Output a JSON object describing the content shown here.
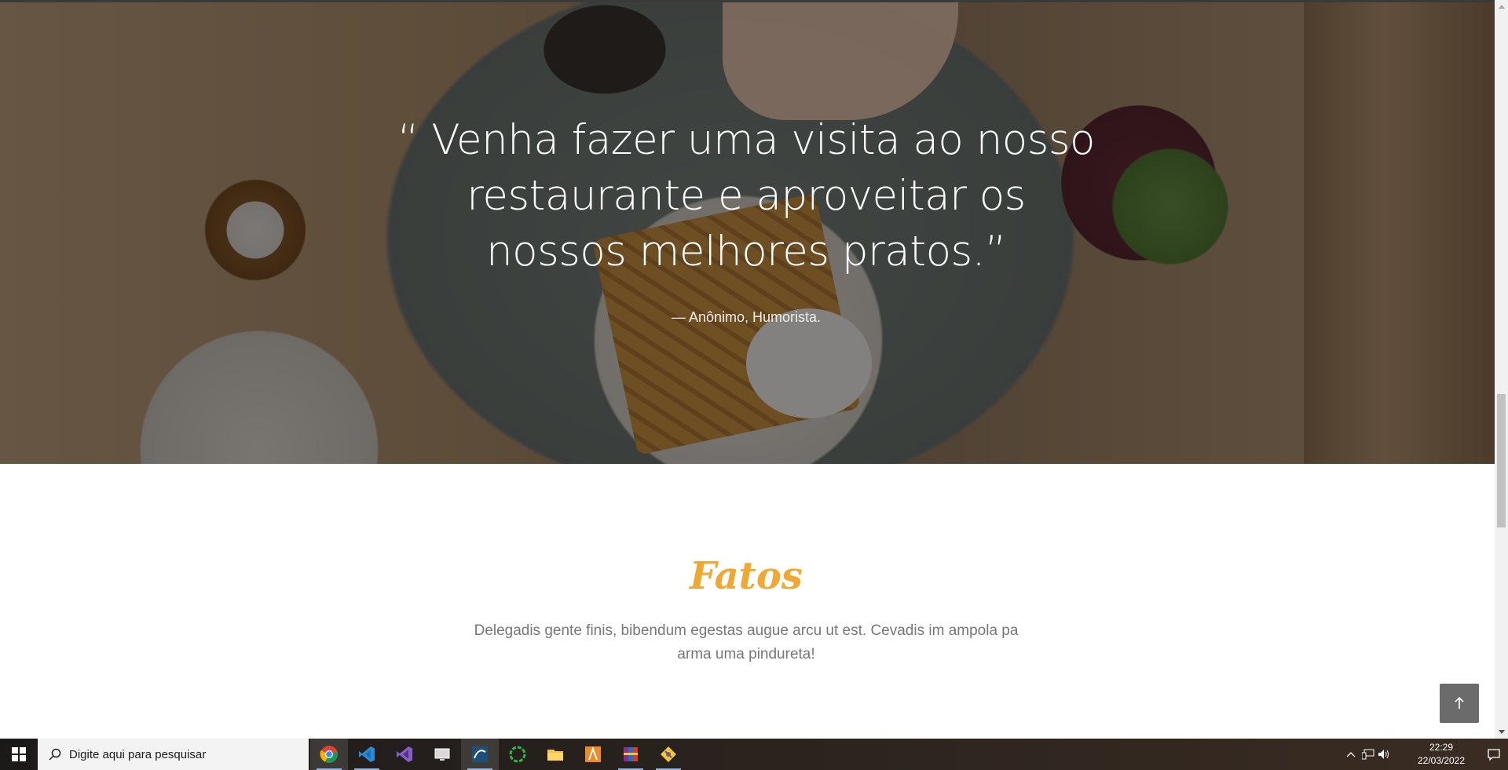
{
  "hero": {
    "quote": "“ Venha fazer uma visita ao nosso restaurante e aproveitar os nossos melhores pratos.”",
    "author": "— Anônimo, Humorista."
  },
  "fatos": {
    "title": "Fatos",
    "description": "Delegadis gente finis, bibendum egestas augue arcu ut est. Cevadis im ampola pa arma uma pindureta!"
  },
  "back_to_top": {
    "icon": "arrow-up-icon"
  },
  "colors": {
    "accent": "#f0a830",
    "text_muted": "#777777",
    "button_bg": "#6b6b6b"
  },
  "taskbar": {
    "search_placeholder": "Digite aqui para pesquisar",
    "apps": [
      "chrome-icon",
      "vscode-icon",
      "visual-studio-icon",
      "virtual-machine-icon",
      "mysql-workbench-icon",
      "spinner-app-icon",
      "file-explorer-icon",
      "sublime-icon",
      "winrar-icon",
      "git-icon"
    ],
    "time": "22:29",
    "date": "22/03/2022"
  }
}
